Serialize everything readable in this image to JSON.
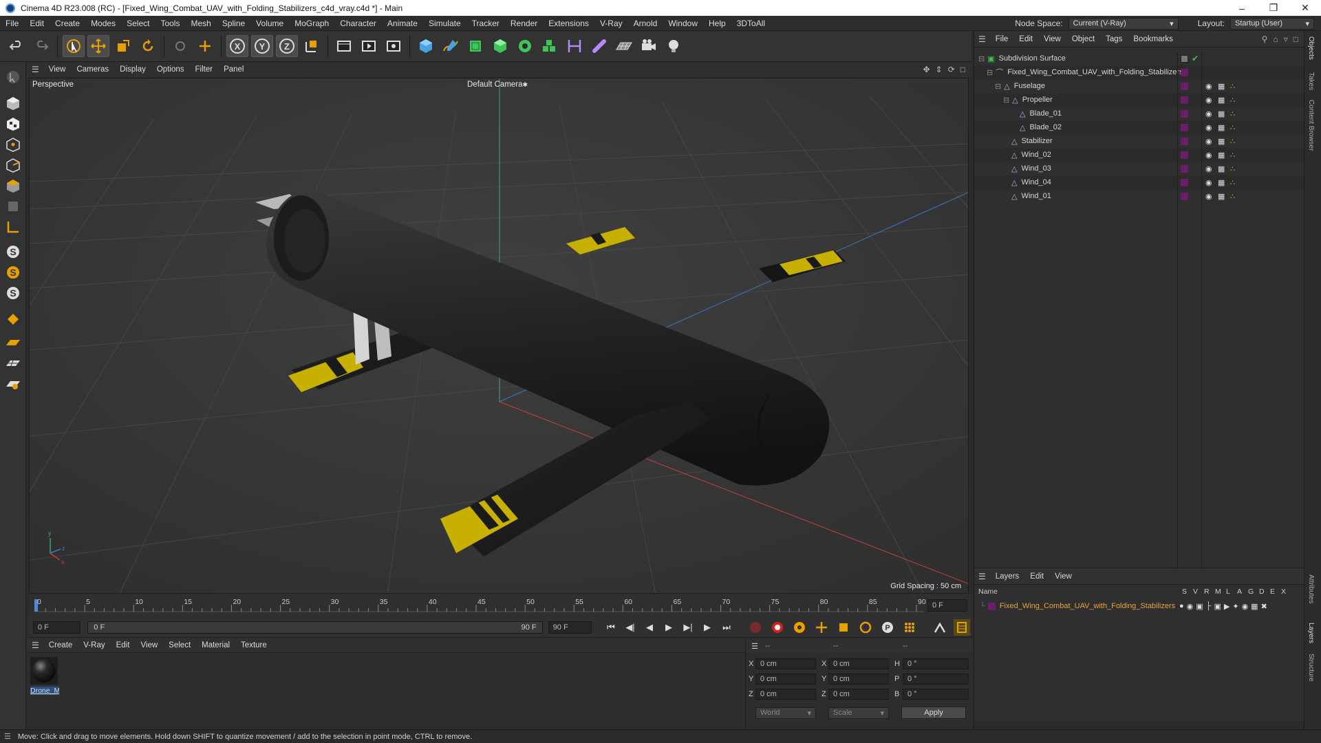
{
  "window": {
    "title": "Cinema 4D R23.008 (RC) - [Fixed_Wing_Combat_UAV_with_Folding_Stabilizers_c4d_vray.c4d *] - Main"
  },
  "menubar": {
    "items": [
      "File",
      "Edit",
      "Create",
      "Modes",
      "Select",
      "Tools",
      "Mesh",
      "Spline",
      "Volume",
      "MoGraph",
      "Character",
      "Animate",
      "Simulate",
      "Tracker",
      "Render",
      "Extensions",
      "V-Ray",
      "Arnold",
      "Window",
      "Help",
      "3DToAll"
    ],
    "node_space_label": "Node Space:",
    "node_space_value": "Current (V-Ray)",
    "layout_label": "Layout:",
    "layout_value": "Startup (User)"
  },
  "viewport": {
    "menu": [
      "View",
      "Cameras",
      "Display",
      "Options",
      "Filter",
      "Panel"
    ],
    "name": "Perspective",
    "camera": "Default Camera",
    "grid_spacing": "Grid Spacing : 50 cm"
  },
  "timeline": {
    "ticks": [
      "0",
      "5",
      "10",
      "15",
      "20",
      "25",
      "30",
      "35",
      "40",
      "45",
      "50",
      "55",
      "60",
      "65",
      "70",
      "75",
      "80",
      "85",
      "90"
    ],
    "current_frame_display": "0 F",
    "start_field": "0 F",
    "range_start": "0 F",
    "range_end": "90 F",
    "end_field": "90 F"
  },
  "material_manager": {
    "menu": [
      "Create",
      "V-Ray",
      "Edit",
      "View",
      "Select",
      "Material",
      "Texture"
    ],
    "materials": [
      {
        "name": "Drone_M"
      }
    ]
  },
  "coordinates": {
    "headers": [
      "--",
      "--",
      "--"
    ],
    "rows": [
      {
        "a_label": "X",
        "a_value": "0 cm",
        "b_label": "X",
        "b_value": "0 cm",
        "c_label": "H",
        "c_value": "0 °"
      },
      {
        "a_label": "Y",
        "a_value": "0 cm",
        "b_label": "Y",
        "b_value": "0 cm",
        "c_label": "P",
        "c_value": "0 °"
      },
      {
        "a_label": "Z",
        "a_value": "0 cm",
        "b_label": "Z",
        "b_value": "0 cm",
        "c_label": "B",
        "c_value": "0 °"
      }
    ],
    "space": "World",
    "mode": "Scale",
    "apply_label": "Apply"
  },
  "object_manager": {
    "menu": [
      "File",
      "Edit",
      "View",
      "Object",
      "Tags",
      "Bookmarks"
    ],
    "objects": [
      {
        "name": "Subdivision Surface"
      },
      {
        "name": "Fixed_Wing_Combat_UAV_with_Folding_Stabilizers"
      },
      {
        "name": "Fuselage"
      },
      {
        "name": "Propeller"
      },
      {
        "name": "Blade_01"
      },
      {
        "name": "Blade_02"
      },
      {
        "name": "Stabilizer"
      },
      {
        "name": "Wind_02"
      },
      {
        "name": "Wind_03"
      },
      {
        "name": "Wind_04"
      },
      {
        "name": "Wind_01"
      }
    ]
  },
  "layer_manager": {
    "menu": [
      "Layers",
      "Edit",
      "View"
    ],
    "name_header": "Name",
    "flag_headers": [
      "S",
      "V",
      "R",
      "M",
      "L",
      "A",
      "G",
      "D",
      "E",
      "X"
    ],
    "layers": [
      {
        "name": "Fixed_Wing_Combat_UAV_with_Folding_Stabilizers"
      }
    ]
  },
  "side_tabs": [
    "Objects",
    "Takes",
    "Content Browser",
    "Attributes",
    "Layers",
    "Structure"
  ],
  "statusbar": {
    "text": "Move: Click and drag to move elements. Hold down SHIFT to quantize movement / add to the selection in point mode, CTRL to remove."
  },
  "colors": {
    "accent_orange": "#e8a000",
    "layer_name_orange": "#e8a33c",
    "layer_swatch": "#6a1e6a",
    "yellow_stripe": "#c8b000"
  }
}
